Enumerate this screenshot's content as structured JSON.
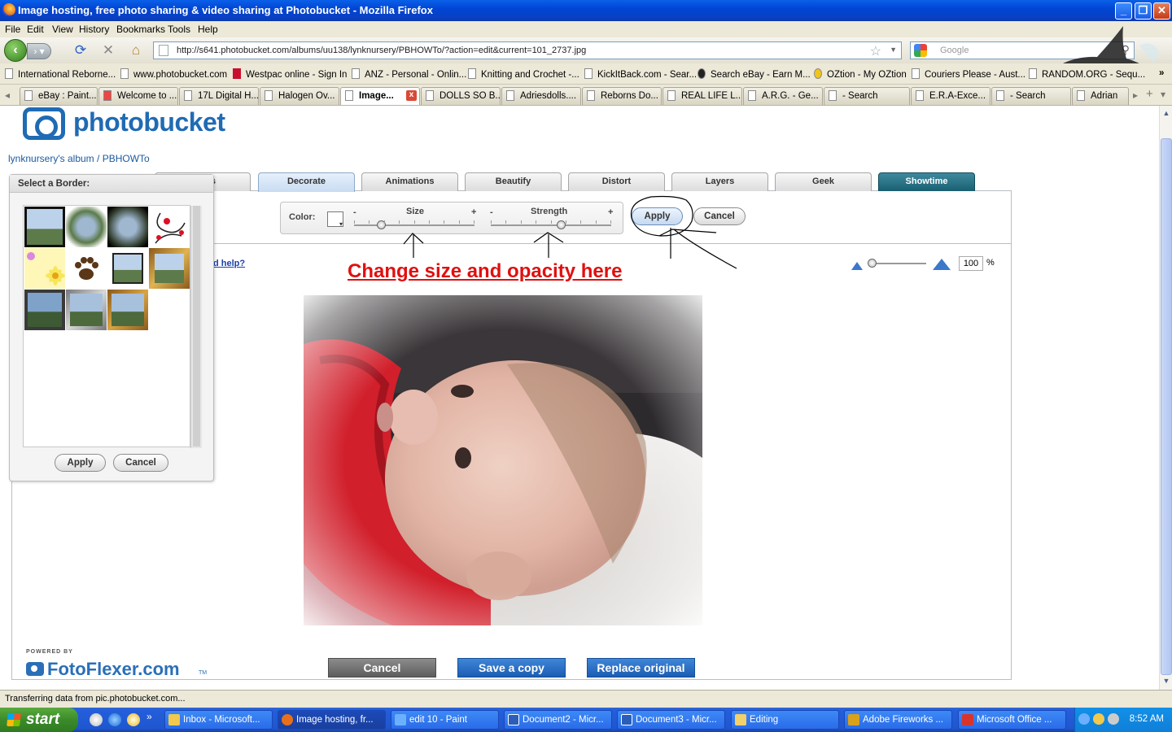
{
  "window": {
    "title": "Image hosting, free photo sharing & video sharing at Photobucket - Mozilla Firefox",
    "minimize": "_",
    "restore": "❐",
    "close": "✕"
  },
  "menu": [
    "File",
    "Edit",
    "View",
    "History",
    "Bookmarks",
    "Tools",
    "Help"
  ],
  "nav": {
    "url": "http://s641.photobucket.com/albums/uu138/lynknursery/PBHOWTo/?action=edit&current=101_2737.jpg",
    "search_placeholder": "Google"
  },
  "bookmarks": [
    "International Reborne...",
    "www.photobucket.com",
    "Westpac online - Sign In",
    "ANZ - Personal - Onlin...",
    "Knitting and Crochet -...",
    "KickItBack.com - Sear...",
    "Search eBay - Earn M...",
    "OZtion - My OZtion",
    "Couriers Please - Aust...",
    "RANDOM.ORG - Sequ..."
  ],
  "tabs": [
    "eBay : Paint...",
    "Welcome to ...",
    "17L Digital H...",
    "Halogen Ov...",
    "Image...",
    "DOLLS SO B...",
    "Adriesdolls....",
    "Reborns Do...",
    "REAL LIFE L...",
    "A.R.G. - Ge...",
    "- Search",
    "E.R.A-Exce...",
    "- Search",
    "Adrian"
  ],
  "page": {
    "logo_text": "photobucket",
    "breadcrumb_album": "lynknursery's album",
    "breadcrumb_sep": "/",
    "breadcrumb_folder": "PBHOWTo",
    "editor_tabs": [
      "s",
      "Decorate",
      "Animations",
      "Beautify",
      "Distort",
      "Layers",
      "Geek",
      "Showtime"
    ],
    "active_tab": "Decorate",
    "controls": {
      "color_label": "Color:",
      "size_label": "Size",
      "strength_label": "Strength",
      "minus": "-",
      "plus": "+",
      "size_value": 0.23,
      "strength_value": 0.59,
      "apply": "Apply",
      "cancel": "Cancel"
    },
    "help_link": "d help?",
    "annotation": "Change size and opacity here",
    "zoom": {
      "value": "100",
      "unit": "%"
    },
    "border_panel": {
      "title": "Select a Border:",
      "apply": "Apply",
      "cancel": "Cancel"
    },
    "buttons": {
      "cancel": "Cancel",
      "save_copy": "Save a copy",
      "replace": "Replace original"
    },
    "powered_by": "POWERED BY",
    "fotoflexer": "FotoFlexer.com",
    "tm": "TM"
  },
  "status": "Transferring data from pic.photobucket.com...",
  "taskbar": {
    "start": "start",
    "tasks": [
      "Inbox - Microsoft...",
      "Image hosting, fr...",
      "edit 10 - Paint",
      "Document2 - Micr...",
      "Document3 - Micr...",
      "Editing",
      "Adobe Fireworks ...",
      "Microsoft Office ..."
    ],
    "clock": "8:52 AM"
  }
}
